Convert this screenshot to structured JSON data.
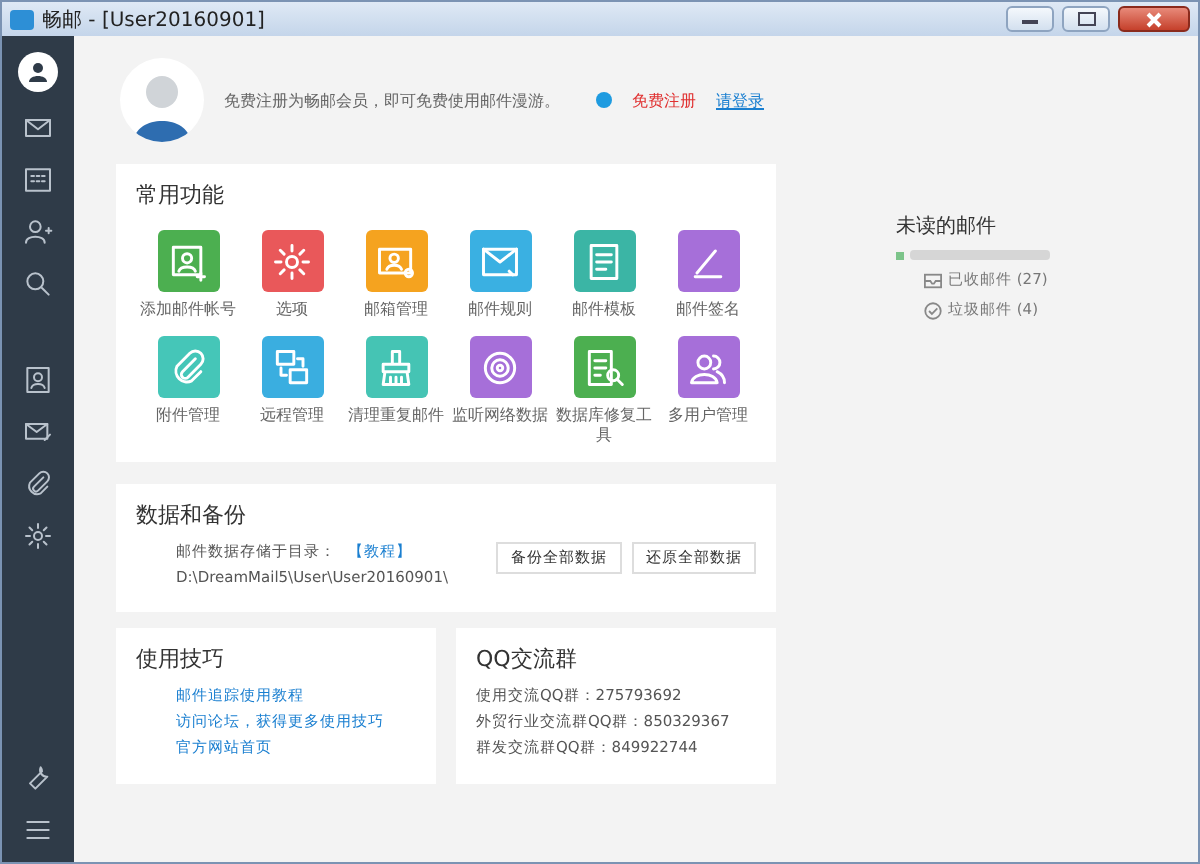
{
  "window": {
    "title": "畅邮 - [User20160901]"
  },
  "header": {
    "notice": "免费注册为畅邮会员，即可免费使用邮件漫游。",
    "register_link": "免费注册",
    "login_link": "请登录"
  },
  "common_functions": {
    "title": "常用功能",
    "items": [
      {
        "label": "添加邮件帐号",
        "color": "#4caf50"
      },
      {
        "label": "选项",
        "color": "#e9585a"
      },
      {
        "label": "邮箱管理",
        "color": "#f5a31f"
      },
      {
        "label": "邮件规则",
        "color": "#3ab0e2"
      },
      {
        "label": "邮件模板",
        "color": "#3bb5a5"
      },
      {
        "label": "邮件签名",
        "color": "#a66fd9"
      },
      {
        "label": "附件管理",
        "color": "#45c6b8"
      },
      {
        "label": "远程管理",
        "color": "#3aaee0"
      },
      {
        "label": "清理重复邮件",
        "color": "#45c4b4"
      },
      {
        "label": "监听网络数据",
        "color": "#a66fd9"
      },
      {
        "label": "数据库修复工具",
        "color": "#4caf50"
      },
      {
        "label": "多用户管理",
        "color": "#a66fd9"
      }
    ]
  },
  "unread": {
    "title": "未读的邮件",
    "folders": [
      {
        "label": "已收邮件 (27)",
        "kind": "inbox"
      },
      {
        "label": "垃圾邮件 (4)",
        "kind": "junk"
      }
    ]
  },
  "backup": {
    "title": "数据和备份",
    "storage_label": "邮件数据存储于目录：",
    "tutorial_link": "【教程】",
    "path": "D:\\DreamMail5\\User\\User20160901\\",
    "buttons": [
      "备份全部数据",
      "还原全部数据"
    ]
  },
  "tips": {
    "title": "使用技巧",
    "links": [
      "邮件追踪使用教程",
      "访问论坛，获得更多使用技巧",
      "官方网站首页"
    ]
  },
  "qq_groups": {
    "title": "QQ交流群",
    "lines": [
      "使用交流QQ群：275793692",
      "外贸行业交流群QQ群：850329367",
      "群发交流群QQ群：849922744"
    ]
  }
}
